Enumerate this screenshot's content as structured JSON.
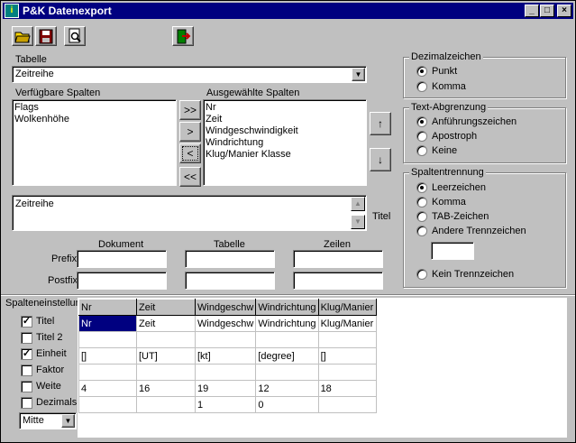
{
  "window": {
    "title": "P&K Datenexport",
    "icon_letter": "i"
  },
  "controls": {
    "minimize": "_",
    "maximize": "□",
    "close": "×"
  },
  "toolbar": {
    "open": "open-folder-icon",
    "save": "save-disk-icon",
    "preview": "print-preview-icon",
    "exit": "exit-door-icon"
  },
  "tabelle": {
    "label": "Tabelle",
    "value": "Zeitreihe"
  },
  "available": {
    "label": "Verfügbare Spalten",
    "items": [
      "Flags",
      "Wolkenhöhe"
    ]
  },
  "selected": {
    "label": "Ausgewählte Spalten",
    "items": [
      "Nr",
      "Zeit",
      "Windgeschwindigkeit",
      "Windrichtung",
      "Klug/Manier Klasse"
    ]
  },
  "move_buttons": {
    "add_all": ">>",
    "add": ">",
    "remove": "<",
    "remove_all": "<<"
  },
  "order_buttons": {
    "up": "↑",
    "down": "↓"
  },
  "title_field": {
    "value": "Zeitreihe",
    "label": "Titel"
  },
  "headers": {
    "dokument": "Dokument",
    "tabelle": "Tabelle",
    "zeilen": "Zeilen",
    "prefix": "Prefix",
    "postfix": "Postfix"
  },
  "decimal": {
    "label": "Dezimalzeichen",
    "options": [
      "Punkt",
      "Komma"
    ],
    "selected": 0
  },
  "textdelim": {
    "label": "Text-Abgrenzung",
    "options": [
      "Anführungszeichen",
      "Apostroph",
      "Keine"
    ],
    "selected": 0
  },
  "colsep": {
    "label": "Spaltentrennung",
    "options": [
      "Leerzeichen",
      "Komma",
      "TAB-Zeichen",
      "Andere Trennzeichen"
    ],
    "last": "Kein Trennzeichen",
    "selected": 0
  },
  "colsettings": {
    "label": "Spalteneinstellungen",
    "rows": [
      {
        "label": "Titel",
        "checked": true
      },
      {
        "label": "Titel 2",
        "checked": false
      },
      {
        "label": "Einheit",
        "checked": true
      },
      {
        "label": "Faktor",
        "checked": false
      },
      {
        "label": "Weite",
        "checked": false
      },
      {
        "label": "Dezimals",
        "checked": false
      }
    ],
    "align": "Mitte"
  },
  "grid": {
    "headers": [
      "Nr",
      "Zeit",
      "Windgeschw",
      "Windrichtung",
      "Klug/Manier"
    ],
    "rows": [
      [
        "Nr",
        "Zeit",
        "Windgeschw",
        "Windrichtung",
        "Klug/Manier"
      ],
      [
        "",
        "",
        "",
        "",
        ""
      ],
      [
        "[]",
        "[UT]",
        "[kt]",
        "[degree]",
        "[]"
      ],
      [
        "",
        "",
        "",
        "",
        ""
      ],
      [
        "4",
        "16",
        "19",
        "12",
        "18"
      ],
      [
        "",
        "",
        "1",
        "0",
        ""
      ]
    ]
  }
}
